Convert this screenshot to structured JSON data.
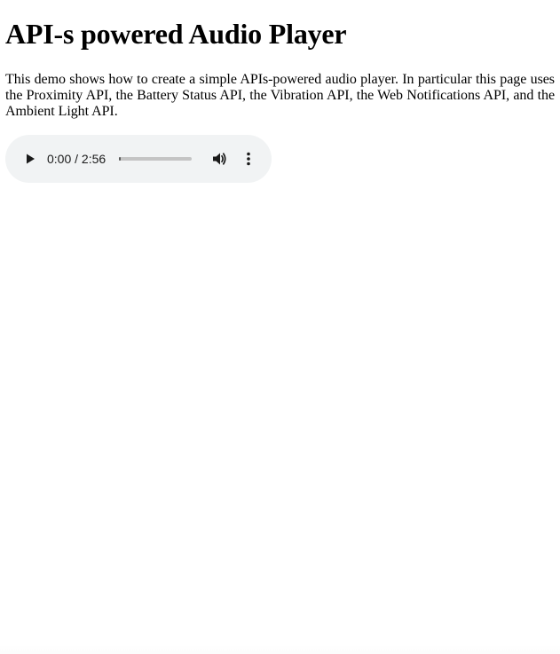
{
  "page": {
    "title": "API-s powered Audio Player",
    "intro": "This demo shows how to create a simple APIs-powered audio player. In particular this page uses the Proximity API, the Battery Status API, the Vibration API, the Web Notifications API, and the Ambient Light API."
  },
  "audio_player": {
    "current_time": "0:00",
    "duration": "2:56",
    "time_display": "0:00 / 2:56",
    "progress": 0.0,
    "icons": {
      "play": "play-icon",
      "volume": "volume-icon",
      "menu": "more-vertical-icon"
    },
    "colors": {
      "background": "#f1f3f4",
      "track": "#c4c4c4",
      "fill": "#5a5a5a"
    }
  }
}
